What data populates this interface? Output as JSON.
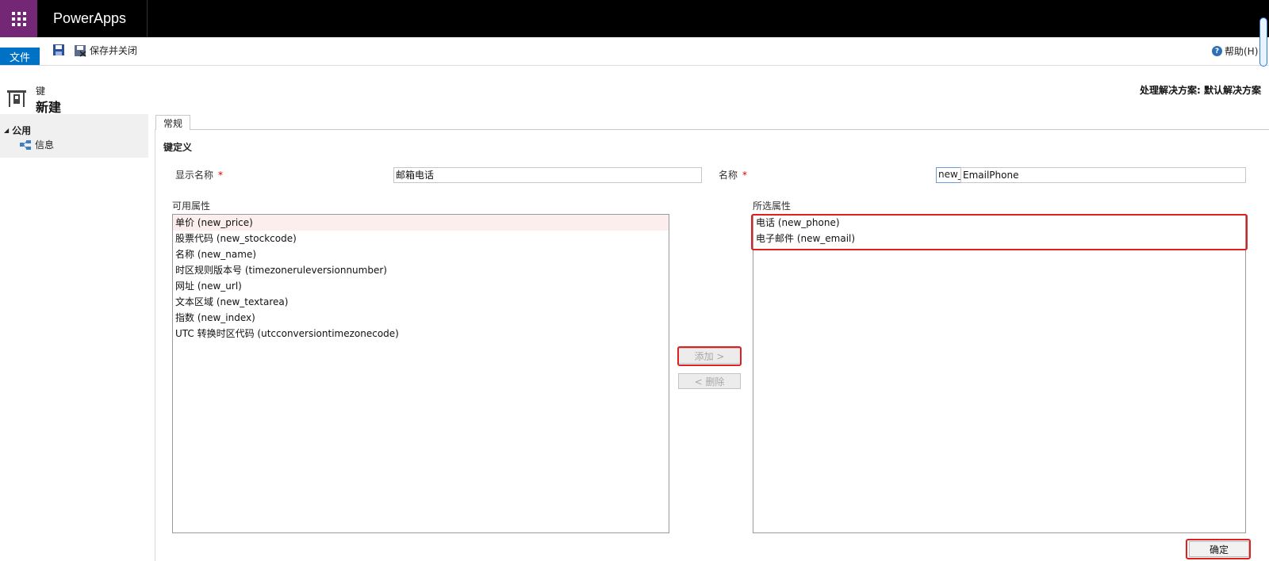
{
  "app": {
    "title": "PowerApps"
  },
  "ribbon": {
    "file_tab": "文件",
    "save_close": "保存并关闭",
    "help": "帮助(H)"
  },
  "header": {
    "entity_type": "键",
    "title": "新建",
    "solution": "处理解决方案: 默认解决方案"
  },
  "nav": {
    "group": "公用",
    "items": [
      {
        "label": "信息"
      }
    ]
  },
  "tabs": [
    {
      "label": "常规"
    }
  ],
  "section": {
    "title": "键定义"
  },
  "form": {
    "display_name_label": "显示名称",
    "display_name_value": "邮箱电话",
    "name_label": "名称",
    "name_prefix": "new_",
    "name_value": "EmailPhone",
    "required_marker": "*"
  },
  "available": {
    "label": "可用属性",
    "items": [
      "单价 (new_price)",
      "股票代码 (new_stockcode)",
      "名称 (new_name)",
      "时区规则版本号 (timezoneruleversionnumber)",
      "网址 (new_url)",
      "文本区域 (new_textarea)",
      "指数 (new_index)",
      "UTC 转换时区代码 (utcconversiontimezonecode)"
    ]
  },
  "selected": {
    "label": "所选属性",
    "items": [
      "电话 (new_phone)",
      "电子邮件 (new_email)"
    ]
  },
  "buttons": {
    "add": "添加 >",
    "remove": "< 删除",
    "ok": "确定"
  },
  "colors": {
    "brand_purple": "#742774",
    "accent_blue": "#0072c6",
    "highlight_red": "#e02020"
  }
}
